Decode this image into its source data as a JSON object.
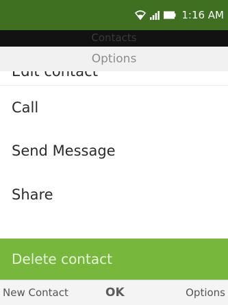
{
  "status_bar": {
    "time": "1:16 AM",
    "icons": [
      "wifi-icon",
      "signal-icon",
      "battery-icon"
    ]
  },
  "background_title": "Contacts",
  "options_header": "Options",
  "menu": {
    "items": [
      "Edit contact",
      "Call",
      "Send Message",
      "Share",
      "Delete contact"
    ],
    "selected_index": 4
  },
  "softkeys": {
    "left": "New Contact",
    "center": "OK",
    "right": "Options"
  },
  "colors": {
    "status_bar": "#3f7021",
    "selected_item": "#77b73c",
    "header_bg": "#f1f1f1"
  }
}
